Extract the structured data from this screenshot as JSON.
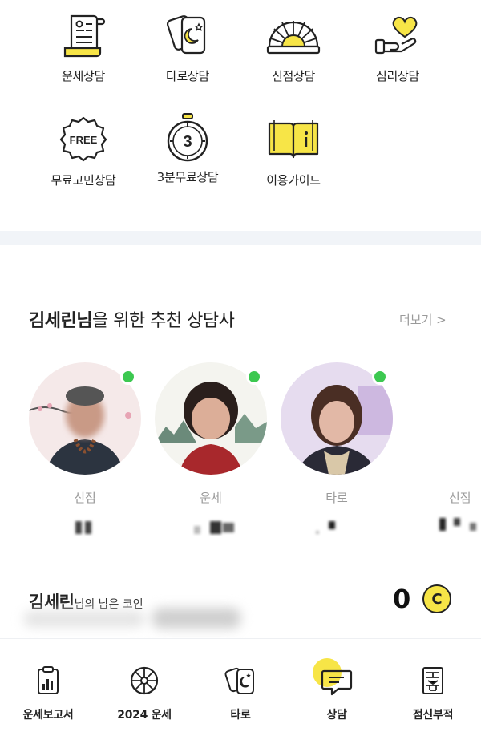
{
  "menu": {
    "items": [
      {
        "label": "운세상담",
        "icon": "scroll-document-icon"
      },
      {
        "label": "타로상담",
        "icon": "tarot-card-icon"
      },
      {
        "label": "신점상담",
        "icon": "fan-icon"
      },
      {
        "label": "심리상담",
        "icon": "heart-hand-icon"
      },
      {
        "label": "무료고민상담",
        "icon": "free-badge-icon"
      },
      {
        "label": "3분무료상담",
        "icon": "stopwatch-icon",
        "badge": "3"
      },
      {
        "label": "이용가이드",
        "icon": "open-book-icon"
      }
    ],
    "free_badge_text": "FREE"
  },
  "recommend": {
    "user_name": "김세린님",
    "title_suffix": "을 위한 추천 상담사",
    "more_label": "더보기 >",
    "counselors": [
      {
        "category": "신점",
        "online": true
      },
      {
        "category": "운세",
        "online": true
      },
      {
        "category": "타로",
        "online": true
      },
      {
        "category": "신점",
        "online": true
      }
    ]
  },
  "coins": {
    "user_name": "김세린",
    "suffix": "님의 남은 코인",
    "count": "0",
    "coin_symbol": "C"
  },
  "bottom_nav": {
    "items": [
      {
        "label": "운세보고서",
        "icon": "report-icon"
      },
      {
        "label": "2024 운세",
        "icon": "wheel-icon"
      },
      {
        "label": "타로",
        "icon": "tarot-card-icon"
      },
      {
        "label": "상담",
        "icon": "chat-bubble-icon",
        "active": true
      },
      {
        "label": "점신부적",
        "icon": "talisman-icon"
      }
    ]
  },
  "colors": {
    "accent_yellow": "#f7e547",
    "online_green": "#3cc850",
    "divider_bg": "#f1f4f8"
  }
}
